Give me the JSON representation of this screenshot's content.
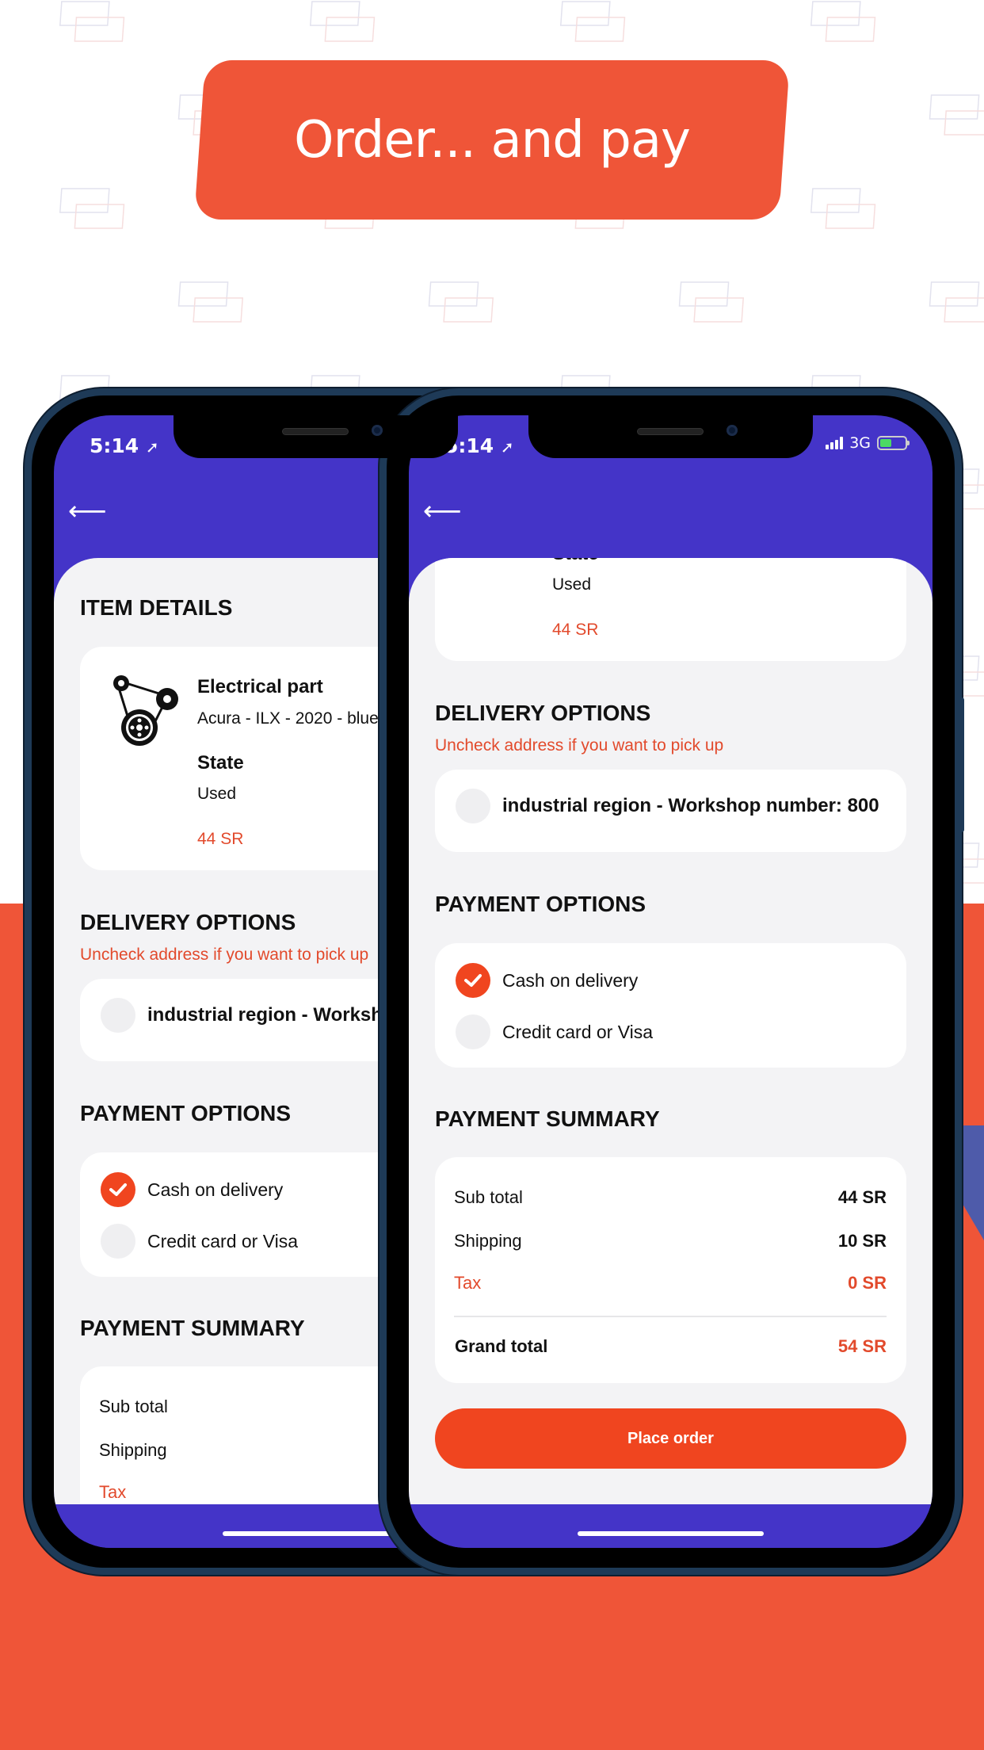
{
  "banner": {
    "title": "Order... and pay"
  },
  "colors": {
    "brand_blue": "#4434C8",
    "accent_orange": "#EF5538",
    "button": "#F0451F",
    "sheet_bg": "#F3F3F5"
  },
  "status_bar": {
    "time": "5:14",
    "network": "3G",
    "icons": [
      "location-arrow-icon",
      "signal-icon",
      "battery-charging-icon"
    ]
  },
  "header": {
    "back_icon": "arrow-left-icon"
  },
  "item_details": {
    "heading": "ITEM DETAILS",
    "icon": "belt-pulley-icon",
    "name": "Electrical part",
    "description": "Acura - ILX - 2020 - blue",
    "state_label": "State",
    "state_value": "Used",
    "price": "44 SR"
  },
  "delivery": {
    "heading": "DELIVERY OPTIONS",
    "hint": "Uncheck address if you want to pick up",
    "address": "industrial region - Workshop number: 800",
    "address_checked": false
  },
  "payment": {
    "heading": "PAYMENT OPTIONS",
    "options": [
      {
        "label": "Cash on delivery",
        "checked": true
      },
      {
        "label": "Credit card or Visa",
        "checked": false
      }
    ]
  },
  "summary": {
    "heading": "PAYMENT SUMMARY",
    "subtotal_label": "Sub total",
    "subtotal_value": "44 SR",
    "shipping_label": "Shipping",
    "shipping_value": "10 SR",
    "tax_label": "Tax",
    "tax_value": "0 SR",
    "grand_label": "Grand total",
    "grand_value": "54 SR"
  },
  "actions": {
    "place_order": "Place order"
  }
}
